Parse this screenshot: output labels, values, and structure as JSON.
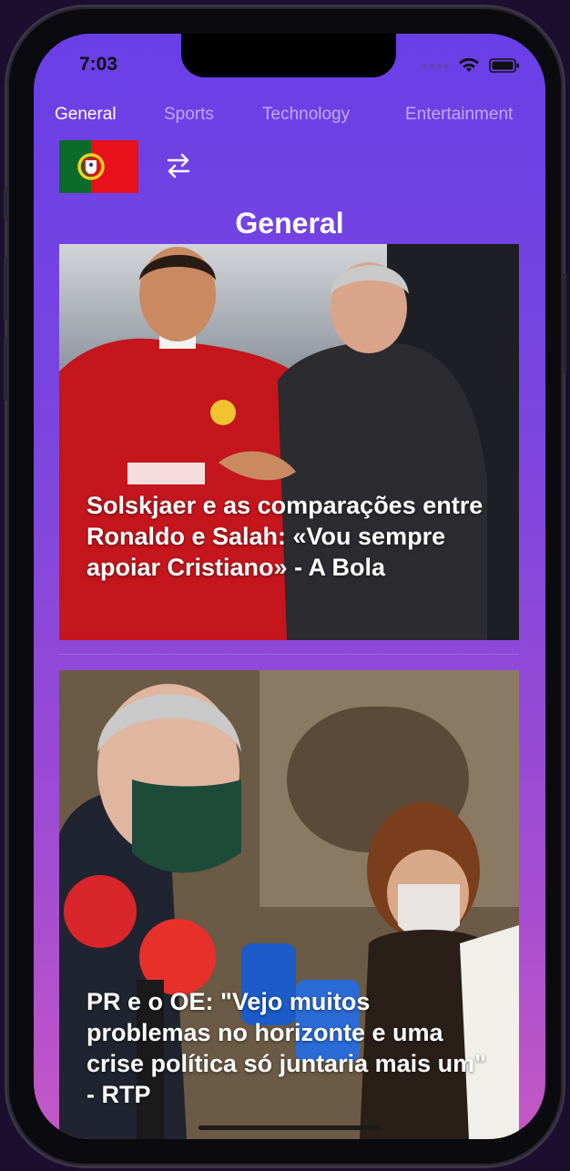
{
  "status_bar": {
    "time": "7:03"
  },
  "tabs": [
    {
      "label": "General",
      "active": true
    },
    {
      "label": "Sports",
      "active": false
    },
    {
      "label": "Technology",
      "active": false
    },
    {
      "label": "Entertainment",
      "active": false
    }
  ],
  "controls": {
    "country_flag": "portugal-flag-icon",
    "swap_icon": "swap-arrows-icon"
  },
  "page": {
    "title": "General"
  },
  "articles": [
    {
      "headline": "Solskjaer e as comparações entre Ronaldo e Salah: «Vou sempre apoiar Cristiano» - A Bola"
    },
    {
      "headline": "PR e o OE: \"Vejo muitos problemas no horizonte e uma crise política só juntaria mais um\" - RTP"
    }
  ],
  "colors": {
    "gradient_top": "#6a3fe8",
    "gradient_bottom": "#c557c6",
    "active_tab": "#ffffff",
    "inactive_tab": "#c7b4f0"
  }
}
